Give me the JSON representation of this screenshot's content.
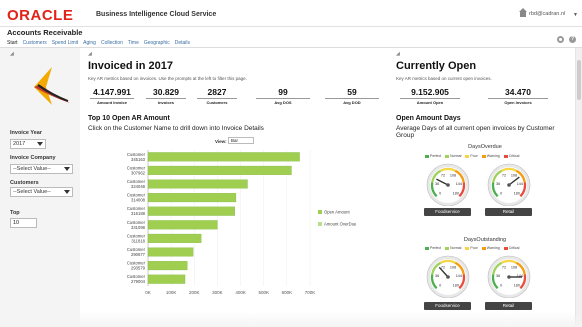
{
  "header": {
    "logo": "ORACLE",
    "app_name": "Business Intelligence Cloud Service",
    "user": "rbd@cadran.nl"
  },
  "page": {
    "title": "Accounts Receivable"
  },
  "tabs": [
    "Start",
    "Customers",
    "Spend Limit",
    "Aging",
    "Collection",
    "Time",
    "Geographic",
    "Details"
  ],
  "filters": {
    "year_label": "Invoice Year",
    "year_value": "2017",
    "company_label": "Invoice Company",
    "company_value": "--Select Value--",
    "customers_label": "Customers",
    "customers_value": "--Select Value--",
    "top_label": "Top",
    "top_value": "10"
  },
  "invoiced": {
    "title": "Invoiced in 2017",
    "subtitle": "Key AR metrics based on invoices. Use the prompts at the left to filter this page.",
    "kpis": [
      {
        "value": "4.147.991",
        "label": "Amount Invoice"
      },
      {
        "value": "30.829",
        "label": "Invoices"
      },
      {
        "value": "2827",
        "label": "Customers"
      },
      {
        "value": "99",
        "label": "Avg DOS"
      },
      {
        "value": "59",
        "label": "Avg DOD"
      }
    ]
  },
  "open": {
    "title": "Currently Open",
    "subtitle": "Key AR metrics based on current open invoices.",
    "kpis": [
      {
        "value": "9.152.905",
        "label": "Amount Open"
      },
      {
        "value": "34.470",
        "label": "Open Invoices"
      }
    ]
  },
  "top10": {
    "title": "Top 10 Open AR Amount",
    "desc": "Click on the Customer Name to drill down into Invoice Details",
    "view_label": "View:",
    "view_value": "Bar"
  },
  "chart_data": {
    "type": "bar",
    "orientation": "horizontal",
    "categories": [
      "Customer 345163",
      "Customer 307962",
      "Customer 324048",
      "Customer 314008",
      "Customer 316188",
      "Customer 331098",
      "Customer 311818",
      "Customer 290677",
      "Customer 293579",
      "Customer 279004"
    ],
    "series": [
      {
        "name": "Open Amount",
        "values": [
          655000,
          620000,
          430000,
          380000,
          375000,
          300000,
          230000,
          195000,
          170000,
          160000
        ]
      },
      {
        "name": "Amount OverDue",
        "values": [
          0,
          0,
          0,
          0,
          0,
          0,
          0,
          0,
          0,
          0
        ]
      }
    ],
    "xticks": [
      "0K",
      "100K",
      "200K",
      "300K",
      "400K",
      "500K",
      "600K",
      "700K"
    ],
    "xlim": [
      0,
      700000
    ],
    "legend": "right",
    "colors": {
      "open": "#9fce50",
      "overdue": "#b9df8a"
    }
  },
  "open_days": {
    "title": "Open Amount Days",
    "desc": "Average Days of all current open invoices by Customer Group",
    "legend": [
      "Perfect",
      "Normal",
      "Poor",
      "Warning",
      "Critical"
    ],
    "legend_colors": [
      "#4caf50",
      "#9fd25b",
      "#f7d545",
      "#f39c12",
      "#e74c3c"
    ],
    "gauge_groups": [
      {
        "title": "DaysOverdue",
        "gauges": [
          {
            "label": "Foodservice",
            "value": 48,
            "ticks": [
              "0",
              "36",
              "72",
              "108",
              "144",
              "180"
            ]
          },
          {
            "label": "Retail",
            "value": 125,
            "ticks": [
              "0",
              "36",
              "72",
              "108",
              "144",
              "180"
            ]
          }
        ]
      },
      {
        "title": "DaysOutstanding",
        "gauges": [
          {
            "label": "Foodservice",
            "value": 62,
            "ticks": [
              "0",
              "36",
              "72",
              "108",
              "144",
              "180"
            ]
          },
          {
            "label": "Retail",
            "value": 150,
            "ticks": [
              "0",
              "36",
              "72",
              "108",
              "144",
              "180"
            ]
          }
        ]
      }
    ]
  }
}
